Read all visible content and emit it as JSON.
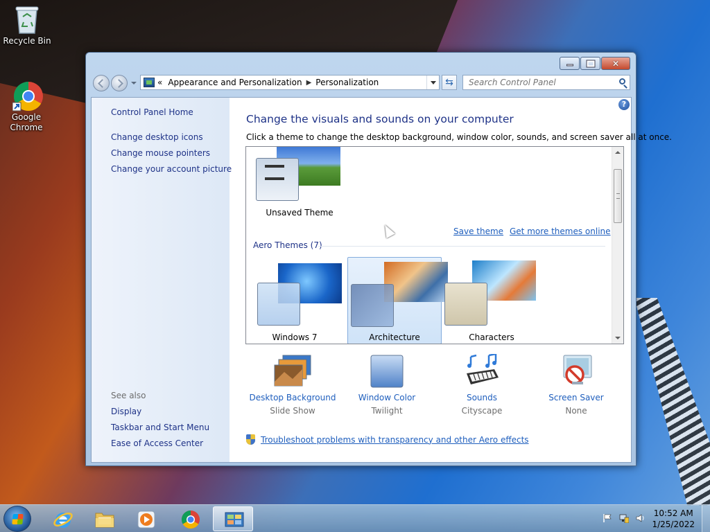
{
  "desktop": {
    "icons": [
      {
        "label": "Recycle Bin"
      },
      {
        "label": "Google Chrome"
      }
    ]
  },
  "window": {
    "address": {
      "back_chevrons": "«",
      "crumbs": [
        "Appearance and Personalization",
        "Personalization"
      ],
      "separator": "▶"
    },
    "search_placeholder": "Search Control Panel",
    "help_glyph": "?",
    "left_pane": {
      "home": "Control Panel Home",
      "tasks": [
        "Change desktop icons",
        "Change mouse pointers",
        "Change your account picture"
      ],
      "see_also_title": "See also",
      "see_also": [
        "Display",
        "Taskbar and Start Menu",
        "Ease of Access Center"
      ]
    },
    "main": {
      "title": "Change the visuals and sounds on your computer",
      "description": "Click a theme to change the desktop background, window color, sounds, and screen saver all at once.",
      "unsaved_theme": "Unsaved Theme",
      "save_theme": "Save theme",
      "get_more_themes": "Get more themes online",
      "group_title": "Aero Themes (7)",
      "themes": [
        {
          "label": "Windows 7",
          "selected": false
        },
        {
          "label": "Architecture",
          "selected": true
        },
        {
          "label": "Characters",
          "selected": false
        }
      ],
      "settings": [
        {
          "title": "Desktop Background",
          "value": "Slide Show"
        },
        {
          "title": "Window Color",
          "value": "Twilight"
        },
        {
          "title": "Sounds",
          "value": "Cityscape"
        },
        {
          "title": "Screen Saver",
          "value": "None"
        }
      ],
      "troubleshoot": "Troubleshoot problems with transparency and other Aero effects"
    }
  },
  "taskbar": {
    "clock_time": "10:52 AM",
    "clock_date": "1/25/2022"
  },
  "colors": {
    "link": "#1e5ebd",
    "heading": "#1e3287",
    "selection_bg": "#cfe3f8"
  }
}
